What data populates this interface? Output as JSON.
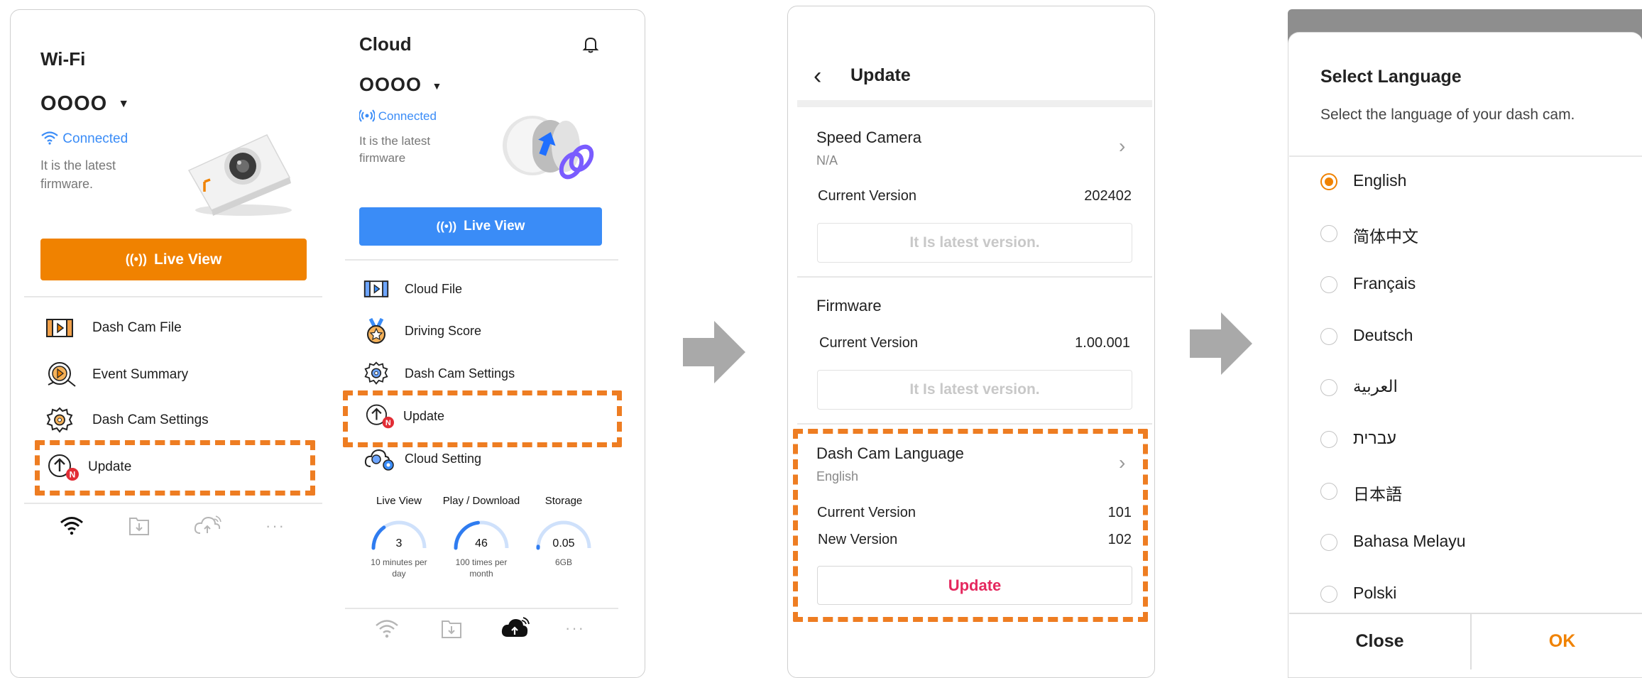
{
  "wifi_screen": {
    "title": "Wi-Fi",
    "device_name": "OOOO",
    "status": "Connected",
    "firmware_note": [
      "It is the latest",
      "firmware."
    ],
    "live_view_label": "Live View",
    "menu": [
      {
        "label": "Dash Cam File",
        "icon": "film-icon"
      },
      {
        "label": "Event Summary",
        "icon": "event-summary-icon"
      },
      {
        "label": "Dash Cam Settings",
        "icon": "gear-icon"
      },
      {
        "label": "Update",
        "icon": "update-icon",
        "badge": "N"
      }
    ],
    "bottom_nav": [
      "wifi-icon",
      "download-icon",
      "cloud-upload-icon",
      "more-icon"
    ]
  },
  "cloud_screen": {
    "title": "Cloud",
    "device_name": "OOOO",
    "status": "Connected",
    "firmware_note": [
      "It is the latest",
      "firmware"
    ],
    "live_view_label": "Live View",
    "menu": [
      {
        "label": "Cloud File",
        "icon": "film-icon"
      },
      {
        "label": "Driving Score",
        "icon": "medal-icon"
      },
      {
        "label": "Dash Cam Settings",
        "icon": "gear-icon"
      },
      {
        "label": "Update",
        "icon": "update-icon",
        "badge": "N"
      },
      {
        "label": "Cloud Setting",
        "icon": "cloud-gear-icon"
      }
    ],
    "stats": [
      {
        "label": "Live View",
        "value": "3",
        "sub": "10 minutes per day",
        "fraction": 0.3
      },
      {
        "label": "Play / Download",
        "value": "46",
        "sub": "100 times per month",
        "fraction": 0.46
      },
      {
        "label": "Storage",
        "value": "0.05",
        "sub": "6GB",
        "fraction": 0.01
      }
    ],
    "bottom_nav": [
      "wifi-icon",
      "download-icon",
      "cloud-upload-icon",
      "more-icon"
    ]
  },
  "update_screen": {
    "title": "Update",
    "speed_camera": {
      "title": "Speed Camera",
      "sub": "N/A",
      "current_label": "Current Version",
      "current_value": "202402",
      "status": "It Is latest version."
    },
    "firmware": {
      "title": "Firmware",
      "current_label": "Current Version",
      "current_value": "1.00.001",
      "status": "It Is latest version."
    },
    "language": {
      "title": "Dash Cam Language",
      "sub": "English",
      "current_label": "Current Version",
      "current_value": "101",
      "new_label": "New Version",
      "new_value": "102",
      "button": "Update"
    }
  },
  "language_screen": {
    "title": "Select Language",
    "subtitle": "Select the language of your dash cam.",
    "options": [
      "English",
      "简体中文",
      "Français",
      "Deutsch",
      "العربية",
      "עברית",
      "日本語",
      "Bahasa Melayu",
      "Polski"
    ],
    "selected": "English",
    "close_label": "Close",
    "ok_label": "OK"
  },
  "colors": {
    "orange": "#f08200",
    "blue": "#3a8cf7",
    "pink": "#e5295f",
    "dash": "#ee7d22",
    "arrow": "#a9a9a9"
  }
}
